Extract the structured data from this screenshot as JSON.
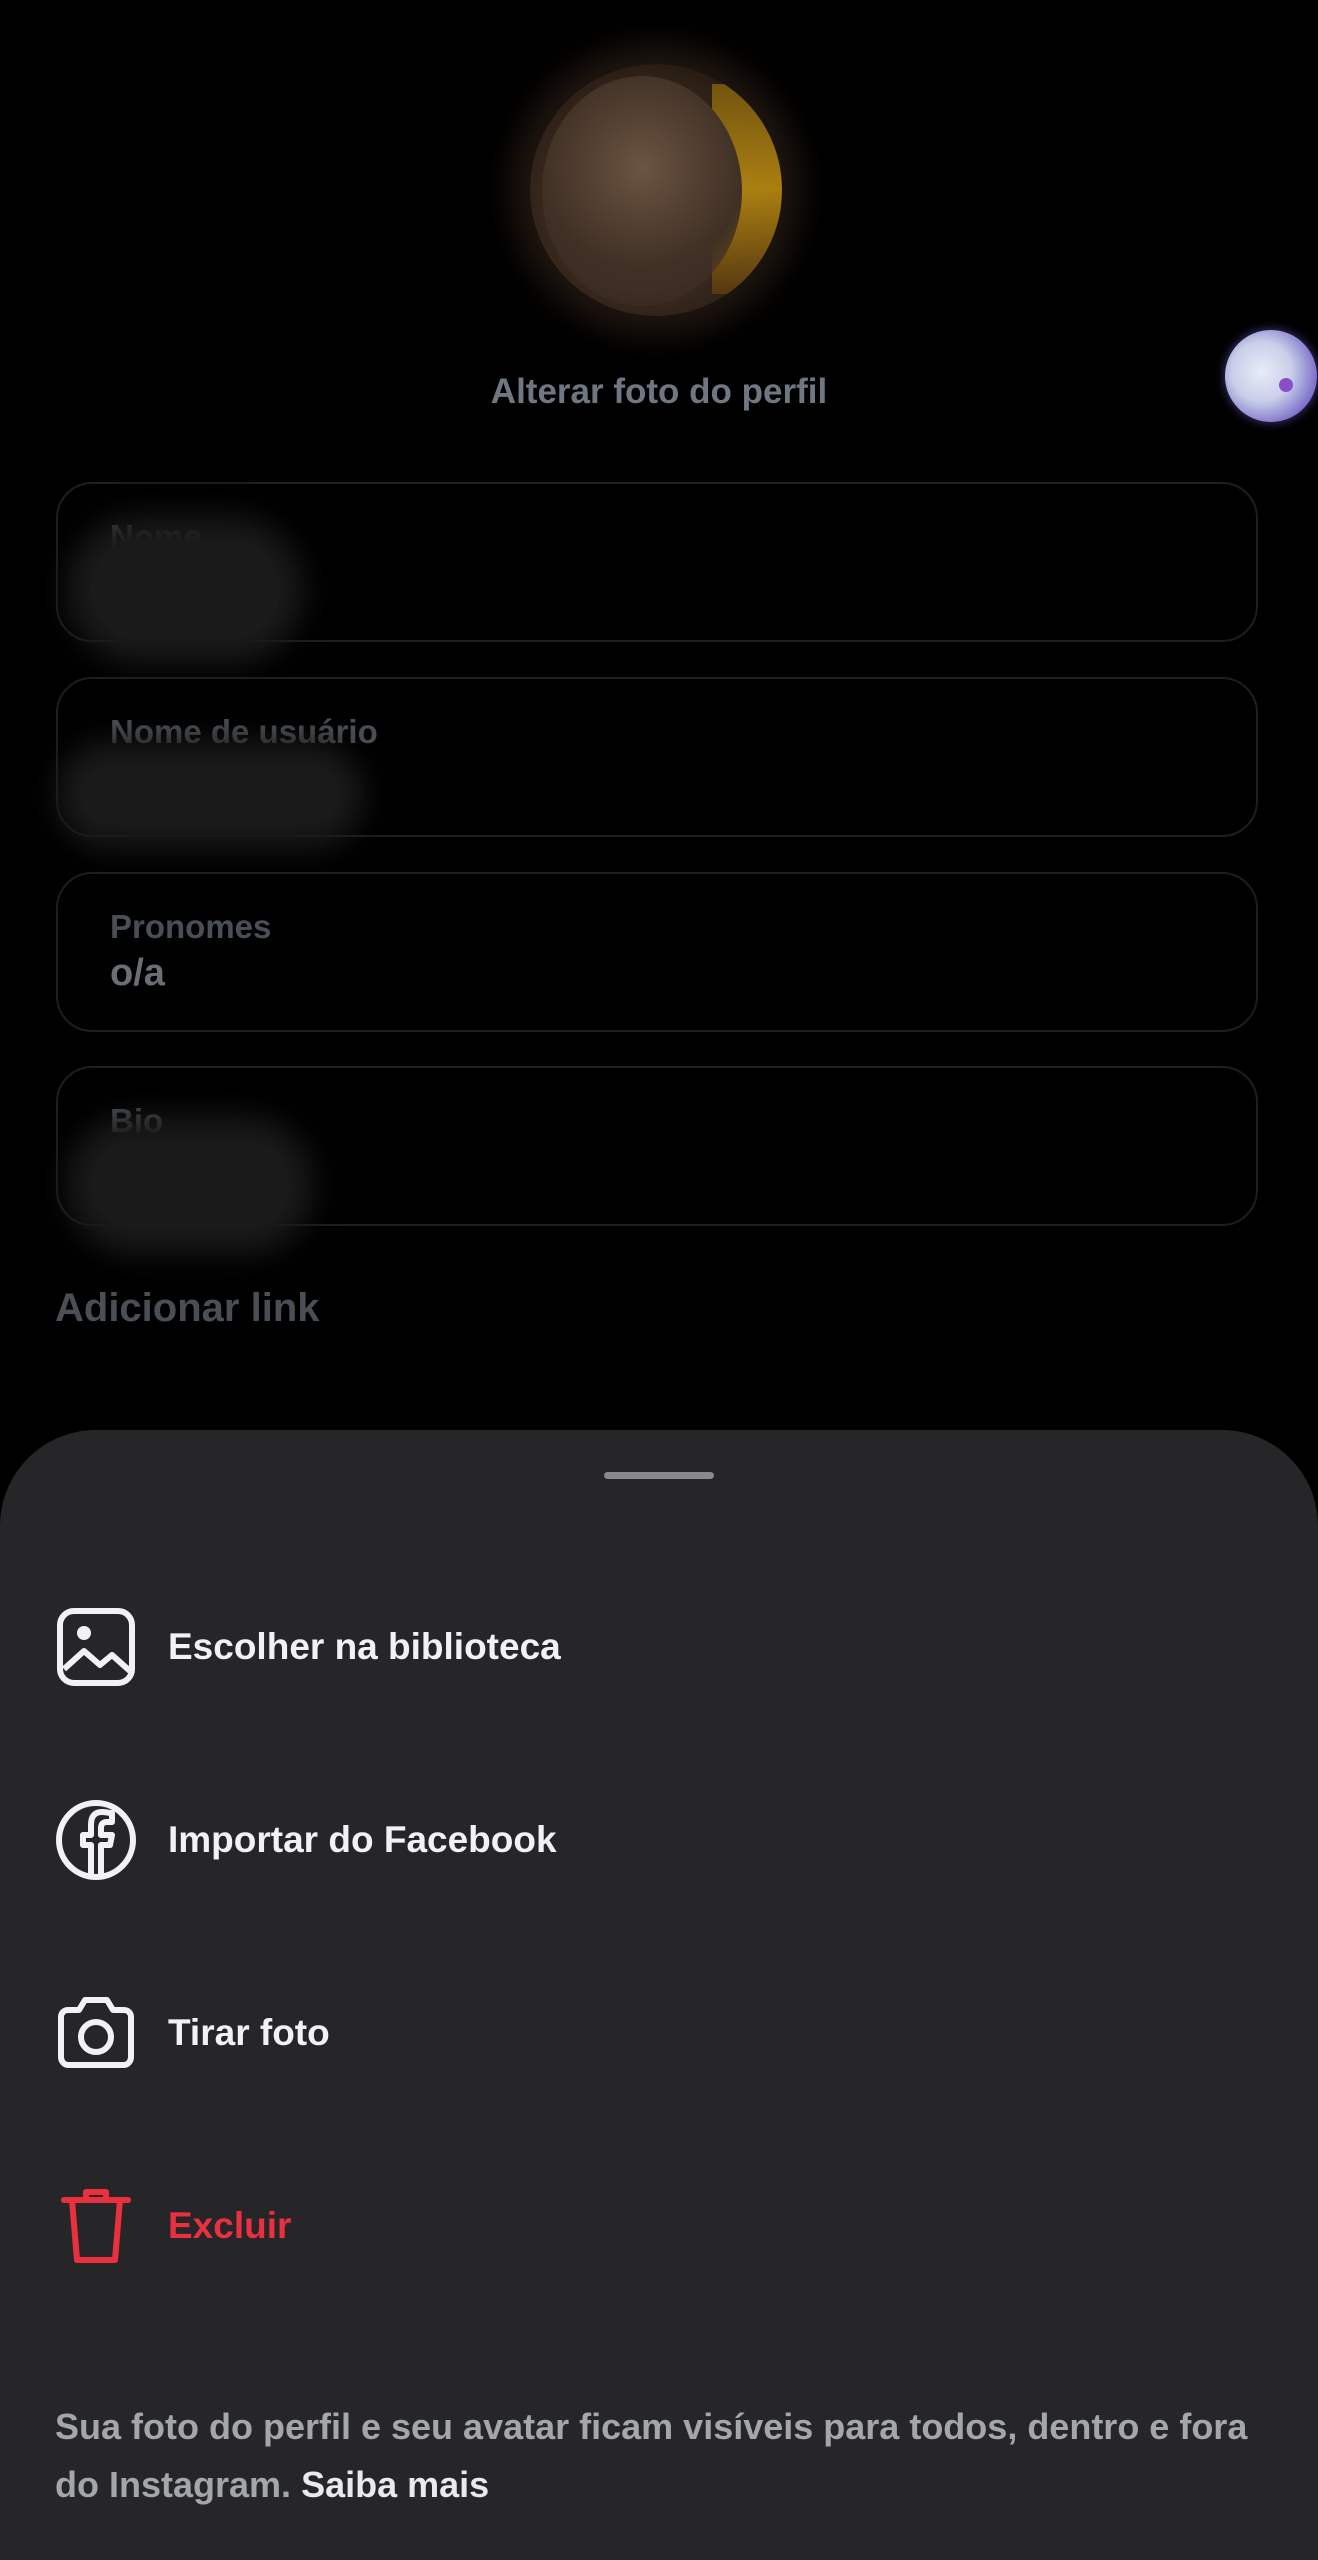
{
  "profile": {
    "change_photo_label": "Alterar foto do perfil"
  },
  "fields": {
    "name": {
      "label": "Nome",
      "value": ""
    },
    "username": {
      "label": "Nome de usuário",
      "value": ""
    },
    "pronouns": {
      "label": "Pronomes",
      "value": "o/a"
    },
    "bio": {
      "label": "Bio",
      "value": ""
    }
  },
  "add_link_label": "Adicionar link",
  "sheet": {
    "options": [
      {
        "label": "Escolher na biblioteca",
        "icon": "image-icon"
      },
      {
        "label": "Importar do Facebook",
        "icon": "facebook-icon"
      },
      {
        "label": "Tirar foto",
        "icon": "camera-icon"
      },
      {
        "label": "Excluir",
        "icon": "trash-icon"
      }
    ],
    "footer_text": "Sua foto do perfil e seu avatar ficam visíveis para todos, dentro e fora do Instagram.",
    "footer_link": "Saiba mais"
  },
  "colors": {
    "sheet_background": "#262628",
    "danger": "#e8303f",
    "page_background": "#000000"
  }
}
